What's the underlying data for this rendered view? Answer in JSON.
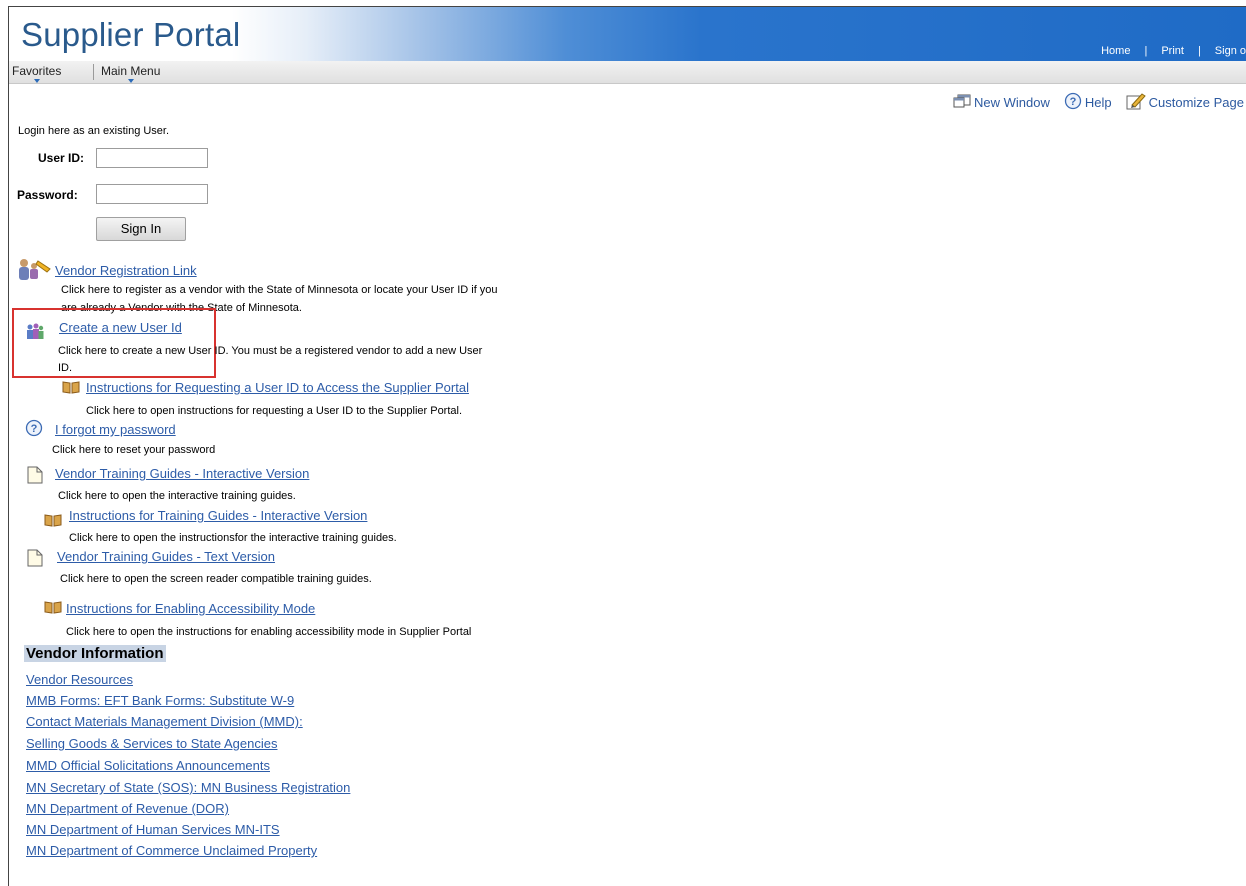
{
  "header": {
    "title": "Supplier Portal",
    "links": [
      "Home",
      "Print",
      "Sign o"
    ]
  },
  "menubar": {
    "items": [
      "Favorites",
      "Main Menu"
    ]
  },
  "pagebar": {
    "items": [
      {
        "label": "New Window",
        "icon": "new-window-icon"
      },
      {
        "label": "Help",
        "icon": "help-icon"
      },
      {
        "label": "Customize Page",
        "icon": "customize-icon"
      }
    ]
  },
  "login": {
    "intro": "Login here as an existing User.",
    "user_id_label": "User ID:",
    "password_label": "Password:",
    "sign_in": "Sign In"
  },
  "links": {
    "vendor_registration": {
      "label": "Vendor Registration Link",
      "desc_line1": "Click here to register as a vendor with the State of Minnesota or locate your User ID if you",
      "desc_line2": "are already a Vendor with the State of Minnesota."
    },
    "create_user": {
      "label": "Create a new User Id",
      "desc_line1": "Click here to create a new User ID. You must be a registered vendor to add a new User",
      "desc_line2": "ID."
    },
    "instructions_request": {
      "label": "Instructions for Requesting a User ID to Access the Supplier Portal",
      "desc": "Click here to open instructions for requesting a User ID to the Supplier Portal."
    },
    "forgot_password": {
      "label": "I forgot my password",
      "desc": "Click here to reset your password"
    },
    "training_interactive": {
      "label": "Vendor Training Guides - Interactive Version",
      "desc": "Click here to open the interactive training guides."
    },
    "instructions_interactive": {
      "label": "Instructions for Training Guides - Interactive Version",
      "desc": "Click here to open the instructionsfor the interactive training guides."
    },
    "training_text": {
      "label": "Vendor Training Guides - Text Version",
      "desc": "Click here to open the screen reader compatible training guides."
    },
    "accessibility": {
      "label": "Instructions for Enabling Accessibility Mode",
      "desc": "Click here to open the instructions  for enabling accessibility mode in Supplier Portal"
    }
  },
  "vendor_info": {
    "heading": "Vendor Information",
    "links": [
      "Vendor Resources",
      "MMB Forms: EFT Bank Forms: Substitute W-9",
      "Contact Materials Management Division (MMD):",
      "Selling Goods & Services to State Agencies",
      "MMD Official Solicitations Announcements",
      "MN Secretary of State (SOS): MN Business Registration",
      "MN Department of Revenue (DOR)",
      "MN Department of Human Services MN-ITS",
      "MN Department of Commerce Unclaimed Property"
    ]
  }
}
